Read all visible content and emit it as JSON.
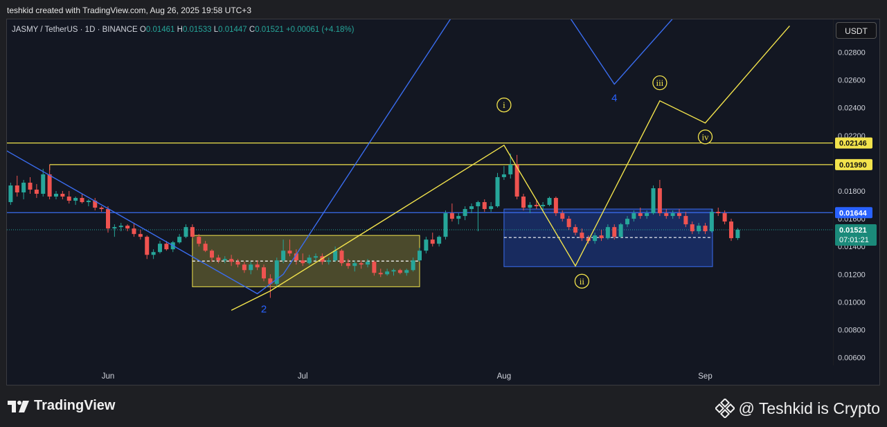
{
  "header": {
    "credit": "teshkid created with TradingView.com, Aug 26, 2025 19:58 UTC+3"
  },
  "symbol_bar": {
    "symbol": "JASMY / TetherUS · 1D · BINANCE",
    "open_label": "O",
    "open": "0.01461",
    "high_label": "H",
    "high": "0.01533",
    "low_label": "L",
    "low": "0.01447",
    "close_label": "C",
    "close": "0.01521",
    "change": "+0.00061 (+4.18%)"
  },
  "currency_button": "USDT",
  "footer": {
    "logo_text": "TradingView",
    "watermark": "@ Teshkid is Crypto"
  },
  "colors": {
    "background": "#131722",
    "up": "#26a69a",
    "down": "#ef5350",
    "yellow": "#f2e34c",
    "blue_line": "#3a6df0",
    "label_blue": "#2962ff",
    "label_green": "#1b8a7a"
  },
  "chart_data": {
    "type": "candlestick",
    "ylim": [
      0.005,
      0.0295
    ],
    "y_ticks": [
      "0.00600",
      "0.00800",
      "0.01000",
      "0.01200",
      "0.01400",
      "0.01600",
      "0.01800",
      "0.02000",
      "0.02200",
      "0.02400",
      "0.02600",
      "0.02800"
    ],
    "x_ticks": [
      {
        "label": "Jun",
        "date": "2025-06-01"
      },
      {
        "label": "Jul",
        "date": "2025-07-01"
      },
      {
        "label": "Aug",
        "date": "2025-08-01"
      },
      {
        "label": "Sep",
        "date": "2025-09-01"
      }
    ],
    "date_range": [
      "2025-05-16",
      "2025-09-13"
    ],
    "candles": [
      {
        "date": "2025-05-16",
        "o": 0.0181,
        "h": 0.019,
        "l": 0.0169,
        "c": 0.0172
      },
      {
        "date": "2025-05-17",
        "o": 0.0172,
        "h": 0.0186,
        "l": 0.017,
        "c": 0.0184
      },
      {
        "date": "2025-05-18",
        "o": 0.0184,
        "h": 0.0191,
        "l": 0.0176,
        "c": 0.0179
      },
      {
        "date": "2025-05-19",
        "o": 0.0179,
        "h": 0.0188,
        "l": 0.0174,
        "c": 0.0186
      },
      {
        "date": "2025-05-20",
        "o": 0.0186,
        "h": 0.019,
        "l": 0.0178,
        "c": 0.0181
      },
      {
        "date": "2025-05-21",
        "o": 0.0181,
        "h": 0.0185,
        "l": 0.0175,
        "c": 0.0178
      },
      {
        "date": "2025-05-22",
        "o": 0.0178,
        "h": 0.0196,
        "l": 0.0176,
        "c": 0.0192
      },
      {
        "date": "2025-05-23",
        "o": 0.0192,
        "h": 0.0199,
        "l": 0.0174,
        "c": 0.0176
      },
      {
        "date": "2025-05-24",
        "o": 0.0176,
        "h": 0.018,
        "l": 0.0174,
        "c": 0.0178
      },
      {
        "date": "2025-05-25",
        "o": 0.0178,
        "h": 0.018,
        "l": 0.0174,
        "c": 0.0176
      },
      {
        "date": "2025-05-26",
        "o": 0.0176,
        "h": 0.018,
        "l": 0.0171,
        "c": 0.0173
      },
      {
        "date": "2025-05-27",
        "o": 0.0173,
        "h": 0.0176,
        "l": 0.017,
        "c": 0.0175
      },
      {
        "date": "2025-05-28",
        "o": 0.0175,
        "h": 0.0178,
        "l": 0.0171,
        "c": 0.0172
      },
      {
        "date": "2025-05-29",
        "o": 0.0172,
        "h": 0.0174,
        "l": 0.0169,
        "c": 0.0173
      },
      {
        "date": "2025-05-30",
        "o": 0.0173,
        "h": 0.0175,
        "l": 0.0166,
        "c": 0.0168
      },
      {
        "date": "2025-05-31",
        "o": 0.0168,
        "h": 0.0169,
        "l": 0.0165,
        "c": 0.0167
      },
      {
        "date": "2025-06-01",
        "o": 0.0167,
        "h": 0.0169,
        "l": 0.015,
        "c": 0.0153
      },
      {
        "date": "2025-06-02",
        "o": 0.0153,
        "h": 0.0156,
        "l": 0.0147,
        "c": 0.0154
      },
      {
        "date": "2025-06-03",
        "o": 0.0154,
        "h": 0.0157,
        "l": 0.0151,
        "c": 0.0155
      },
      {
        "date": "2025-06-04",
        "o": 0.0155,
        "h": 0.0156,
        "l": 0.0151,
        "c": 0.0153
      },
      {
        "date": "2025-06-05",
        "o": 0.0153,
        "h": 0.0157,
        "l": 0.0147,
        "c": 0.0149
      },
      {
        "date": "2025-06-06",
        "o": 0.0149,
        "h": 0.0152,
        "l": 0.0145,
        "c": 0.0147
      },
      {
        "date": "2025-06-07",
        "o": 0.0147,
        "h": 0.0148,
        "l": 0.0131,
        "c": 0.0134
      },
      {
        "date": "2025-06-08",
        "o": 0.0134,
        "h": 0.0138,
        "l": 0.0131,
        "c": 0.0136
      },
      {
        "date": "2025-06-09",
        "o": 0.0136,
        "h": 0.0144,
        "l": 0.0135,
        "c": 0.0142
      },
      {
        "date": "2025-06-10",
        "o": 0.0142,
        "h": 0.0144,
        "l": 0.0137,
        "c": 0.0138
      },
      {
        "date": "2025-06-11",
        "o": 0.0138,
        "h": 0.0144,
        "l": 0.0136,
        "c": 0.0143
      },
      {
        "date": "2025-06-12",
        "o": 0.0143,
        "h": 0.0149,
        "l": 0.0142,
        "c": 0.0147
      },
      {
        "date": "2025-06-13",
        "o": 0.0147,
        "h": 0.0156,
        "l": 0.0146,
        "c": 0.0154
      },
      {
        "date": "2025-06-14",
        "o": 0.0154,
        "h": 0.0156,
        "l": 0.0146,
        "c": 0.0147
      },
      {
        "date": "2025-06-15",
        "o": 0.0147,
        "h": 0.0149,
        "l": 0.014,
        "c": 0.0142
      },
      {
        "date": "2025-06-16",
        "o": 0.0142,
        "h": 0.0144,
        "l": 0.0136,
        "c": 0.0137
      },
      {
        "date": "2025-06-17",
        "o": 0.0137,
        "h": 0.0138,
        "l": 0.0129,
        "c": 0.0132
      },
      {
        "date": "2025-06-18",
        "o": 0.0132,
        "h": 0.0134,
        "l": 0.0128,
        "c": 0.013
      },
      {
        "date": "2025-06-19",
        "o": 0.013,
        "h": 0.0133,
        "l": 0.0128,
        "c": 0.0131
      },
      {
        "date": "2025-06-20",
        "o": 0.0131,
        "h": 0.0134,
        "l": 0.0126,
        "c": 0.0129
      },
      {
        "date": "2025-06-21",
        "o": 0.0129,
        "h": 0.0131,
        "l": 0.0125,
        "c": 0.0127
      },
      {
        "date": "2025-06-22",
        "o": 0.0127,
        "h": 0.0129,
        "l": 0.0121,
        "c": 0.0123
      },
      {
        "date": "2025-06-23",
        "o": 0.0123,
        "h": 0.0129,
        "l": 0.012,
        "c": 0.0127
      },
      {
        "date": "2025-06-24",
        "o": 0.0127,
        "h": 0.013,
        "l": 0.0123,
        "c": 0.0125
      },
      {
        "date": "2025-06-25",
        "o": 0.0125,
        "h": 0.0127,
        "l": 0.0115,
        "c": 0.0117
      },
      {
        "date": "2025-06-26",
        "o": 0.0117,
        "h": 0.012,
        "l": 0.0103,
        "c": 0.0113
      },
      {
        "date": "2025-06-27",
        "o": 0.0113,
        "h": 0.0132,
        "l": 0.0111,
        "c": 0.013
      },
      {
        "date": "2025-06-28",
        "o": 0.013,
        "h": 0.0145,
        "l": 0.0128,
        "c": 0.0137
      },
      {
        "date": "2025-06-29",
        "o": 0.0137,
        "h": 0.0145,
        "l": 0.0133,
        "c": 0.0135
      },
      {
        "date": "2025-06-30",
        "o": 0.0135,
        "h": 0.0138,
        "l": 0.0127,
        "c": 0.013
      },
      {
        "date": "2025-07-01",
        "o": 0.013,
        "h": 0.0135,
        "l": 0.0126,
        "c": 0.0128
      },
      {
        "date": "2025-07-02",
        "o": 0.0128,
        "h": 0.0134,
        "l": 0.0127,
        "c": 0.0132
      },
      {
        "date": "2025-07-03",
        "o": 0.0132,
        "h": 0.0135,
        "l": 0.013,
        "c": 0.0133
      },
      {
        "date": "2025-07-04",
        "o": 0.0133,
        "h": 0.0135,
        "l": 0.0127,
        "c": 0.0129
      },
      {
        "date": "2025-07-05",
        "o": 0.0129,
        "h": 0.0132,
        "l": 0.0127,
        "c": 0.013
      },
      {
        "date": "2025-07-06",
        "o": 0.013,
        "h": 0.014,
        "l": 0.0129,
        "c": 0.0137
      },
      {
        "date": "2025-07-07",
        "o": 0.0137,
        "h": 0.0138,
        "l": 0.0126,
        "c": 0.0128
      },
      {
        "date": "2025-07-08",
        "o": 0.0128,
        "h": 0.0131,
        "l": 0.0124,
        "c": 0.0126
      },
      {
        "date": "2025-07-09",
        "o": 0.0126,
        "h": 0.013,
        "l": 0.0122,
        "c": 0.0128
      },
      {
        "date": "2025-07-10",
        "o": 0.0128,
        "h": 0.013,
        "l": 0.0124,
        "c": 0.0127
      },
      {
        "date": "2025-07-11",
        "o": 0.0127,
        "h": 0.0131,
        "l": 0.0125,
        "c": 0.0129
      },
      {
        "date": "2025-07-12",
        "o": 0.0129,
        "h": 0.013,
        "l": 0.0119,
        "c": 0.0121
      },
      {
        "date": "2025-07-13",
        "o": 0.0121,
        "h": 0.0124,
        "l": 0.0118,
        "c": 0.012
      },
      {
        "date": "2025-07-14",
        "o": 0.012,
        "h": 0.0124,
        "l": 0.0119,
        "c": 0.0122
      },
      {
        "date": "2025-07-15",
        "o": 0.0122,
        "h": 0.0124,
        "l": 0.0119,
        "c": 0.0123
      },
      {
        "date": "2025-07-16",
        "o": 0.0123,
        "h": 0.0124,
        "l": 0.012,
        "c": 0.0121
      },
      {
        "date": "2025-07-17",
        "o": 0.0121,
        "h": 0.0124,
        "l": 0.0119,
        "c": 0.0123
      },
      {
        "date": "2025-07-18",
        "o": 0.0123,
        "h": 0.0132,
        "l": 0.0122,
        "c": 0.013
      },
      {
        "date": "2025-07-19",
        "o": 0.013,
        "h": 0.0139,
        "l": 0.0129,
        "c": 0.0137
      },
      {
        "date": "2025-07-20",
        "o": 0.0137,
        "h": 0.0147,
        "l": 0.0135,
        "c": 0.0145
      },
      {
        "date": "2025-07-21",
        "o": 0.0145,
        "h": 0.015,
        "l": 0.014,
        "c": 0.0142
      },
      {
        "date": "2025-07-22",
        "o": 0.0142,
        "h": 0.0148,
        "l": 0.014,
        "c": 0.0147
      },
      {
        "date": "2025-07-23",
        "o": 0.0147,
        "h": 0.0166,
        "l": 0.0145,
        "c": 0.0164
      },
      {
        "date": "2025-07-24",
        "o": 0.0164,
        "h": 0.0171,
        "l": 0.0158,
        "c": 0.016
      },
      {
        "date": "2025-07-25",
        "o": 0.016,
        "h": 0.0164,
        "l": 0.0156,
        "c": 0.0162
      },
      {
        "date": "2025-07-26",
        "o": 0.0162,
        "h": 0.0169,
        "l": 0.0159,
        "c": 0.0167
      },
      {
        "date": "2025-07-27",
        "o": 0.0167,
        "h": 0.0171,
        "l": 0.0164,
        "c": 0.0169
      },
      {
        "date": "2025-07-28",
        "o": 0.0169,
        "h": 0.0173,
        "l": 0.0151,
        "c": 0.0172
      },
      {
        "date": "2025-07-29",
        "o": 0.0172,
        "h": 0.0174,
        "l": 0.0165,
        "c": 0.0167
      },
      {
        "date": "2025-07-30",
        "o": 0.0167,
        "h": 0.0172,
        "l": 0.0165,
        "c": 0.0169
      },
      {
        "date": "2025-07-31",
        "o": 0.0169,
        "h": 0.0193,
        "l": 0.0168,
        "c": 0.019
      },
      {
        "date": "2025-08-01",
        "o": 0.019,
        "h": 0.0198,
        "l": 0.0188,
        "c": 0.0192
      },
      {
        "date": "2025-08-02",
        "o": 0.0192,
        "h": 0.0207,
        "l": 0.0189,
        "c": 0.0199
      },
      {
        "date": "2025-08-03",
        "o": 0.0199,
        "h": 0.0206,
        "l": 0.0174,
        "c": 0.0176
      },
      {
        "date": "2025-08-04",
        "o": 0.0176,
        "h": 0.0178,
        "l": 0.0166,
        "c": 0.0168
      },
      {
        "date": "2025-08-05",
        "o": 0.0168,
        "h": 0.0172,
        "l": 0.0164,
        "c": 0.017
      },
      {
        "date": "2025-08-06",
        "o": 0.017,
        "h": 0.0174,
        "l": 0.0167,
        "c": 0.0169
      },
      {
        "date": "2025-08-07",
        "o": 0.0169,
        "h": 0.0172,
        "l": 0.0165,
        "c": 0.017
      },
      {
        "date": "2025-08-08",
        "o": 0.017,
        "h": 0.0176,
        "l": 0.0169,
        "c": 0.0175
      },
      {
        "date": "2025-08-09",
        "o": 0.0175,
        "h": 0.0176,
        "l": 0.0162,
        "c": 0.0164
      },
      {
        "date": "2025-08-10",
        "o": 0.0164,
        "h": 0.0166,
        "l": 0.0158,
        "c": 0.016
      },
      {
        "date": "2025-08-11",
        "o": 0.016,
        "h": 0.0162,
        "l": 0.0152,
        "c": 0.0154
      },
      {
        "date": "2025-08-12",
        "o": 0.0154,
        "h": 0.0156,
        "l": 0.0148,
        "c": 0.015
      },
      {
        "date": "2025-08-13",
        "o": 0.015,
        "h": 0.0153,
        "l": 0.0144,
        "c": 0.0146
      },
      {
        "date": "2025-08-14",
        "o": 0.0146,
        "h": 0.0148,
        "l": 0.0142,
        "c": 0.0144
      },
      {
        "date": "2025-08-15",
        "o": 0.0144,
        "h": 0.015,
        "l": 0.0142,
        "c": 0.0148
      },
      {
        "date": "2025-08-16",
        "o": 0.0148,
        "h": 0.0152,
        "l": 0.0144,
        "c": 0.0146
      },
      {
        "date": "2025-08-17",
        "o": 0.0146,
        "h": 0.0156,
        "l": 0.0145,
        "c": 0.0154
      },
      {
        "date": "2025-08-18",
        "o": 0.0154,
        "h": 0.0156,
        "l": 0.0145,
        "c": 0.0147
      },
      {
        "date": "2025-08-19",
        "o": 0.0147,
        "h": 0.0157,
        "l": 0.0146,
        "c": 0.0156
      },
      {
        "date": "2025-08-20",
        "o": 0.0156,
        "h": 0.0162,
        "l": 0.0154,
        "c": 0.016
      },
      {
        "date": "2025-08-21",
        "o": 0.016,
        "h": 0.0166,
        "l": 0.0158,
        "c": 0.0164
      },
      {
        "date": "2025-08-22",
        "o": 0.0164,
        "h": 0.0168,
        "l": 0.016,
        "c": 0.0162
      },
      {
        "date": "2025-08-23",
        "o": 0.0162,
        "h": 0.0166,
        "l": 0.016,
        "c": 0.0164
      },
      {
        "date": "2025-08-24",
        "o": 0.0164,
        "h": 0.0184,
        "l": 0.0163,
        "c": 0.0182
      },
      {
        "date": "2025-08-25",
        "o": 0.0182,
        "h": 0.0188,
        "l": 0.0162,
        "c": 0.0164
      },
      {
        "date": "2025-08-26",
        "o": 0.0164,
        "h": 0.0167,
        "l": 0.016,
        "c": 0.0162
      },
      {
        "date": "2025-08-27",
        "o": 0.0162,
        "h": 0.0166,
        "l": 0.016,
        "c": 0.0164
      },
      {
        "date": "2025-08-28",
        "o": 0.0164,
        "h": 0.0167,
        "l": 0.016,
        "c": 0.0162
      },
      {
        "date": "2025-08-29",
        "o": 0.0162,
        "h": 0.0165,
        "l": 0.0154,
        "c": 0.0156
      },
      {
        "date": "2025-08-30",
        "o": 0.0156,
        "h": 0.0158,
        "l": 0.0149,
        "c": 0.0151
      },
      {
        "date": "2025-08-31",
        "o": 0.0151,
        "h": 0.0157,
        "l": 0.0149,
        "c": 0.0155
      },
      {
        "date": "2025-09-01",
        "o": 0.0155,
        "h": 0.0157,
        "l": 0.0149,
        "c": 0.0151
      },
      {
        "date": "2025-09-02",
        "o": 0.0151,
        "h": 0.0167,
        "l": 0.015,
        "c": 0.0165
      },
      {
        "date": "2025-09-03",
        "o": 0.0165,
        "h": 0.0168,
        "l": 0.0162,
        "c": 0.0164
      },
      {
        "date": "2025-09-04",
        "o": 0.0164,
        "h": 0.0166,
        "l": 0.0156,
        "c": 0.0158
      },
      {
        "date": "2025-09-05",
        "o": 0.0158,
        "h": 0.016,
        "l": 0.0144,
        "c": 0.0146
      },
      {
        "date": "2025-09-06",
        "o": 0.01461,
        "h": 0.01533,
        "l": 0.01447,
        "c": 0.01521
      }
    ],
    "horizontal_lines": [
      {
        "price": 0.02146,
        "label": "0.02146",
        "color": "yellow"
      },
      {
        "price": 0.0199,
        "label": "0.01990",
        "color": "yellow",
        "start": "2025-05-23"
      },
      {
        "price": 0.01644,
        "label": "0.01644",
        "color": "blue"
      }
    ],
    "last_price": {
      "price": 0.01521,
      "label": "0.01521",
      "countdown": "07:01:21"
    },
    "zones": [
      {
        "color": "yellow",
        "start": "2025-06-14",
        "end": "2025-07-19",
        "top": 0.0148,
        "bottom": 0.0111,
        "mid": 0.01295
      },
      {
        "color": "blue",
        "start": "2025-08-01",
        "end": "2025-09-14",
        "top": 0.0167,
        "bottom": 0.01255,
        "mid": 0.01465
      }
    ],
    "wave_lines": [
      {
        "color": "yellow",
        "points": [
          [
            "2025-06-20",
            0.0094
          ],
          [
            "2025-06-26",
            0.0108
          ],
          [
            "2025-08-01",
            0.0213
          ],
          [
            "2025-08-12",
            0.0126
          ],
          [
            "2025-08-25",
            0.0245
          ],
          [
            "2025-09-01",
            0.0229
          ],
          [
            "2025-09-14",
            0.0299
          ]
        ]
      },
      {
        "color": "blue",
        "points": [
          [
            "2025-05-16",
            0.021
          ],
          [
            "2025-06-24",
            0.0106
          ],
          [
            "2025-06-28",
            0.012
          ],
          [
            "2025-07-26",
            0.032
          ]
        ]
      },
      {
        "color": "blue",
        "points": [
          [
            "2025-08-09",
            0.032
          ],
          [
            "2025-08-18",
            0.0257
          ],
          [
            "2025-08-30",
            0.032
          ]
        ]
      }
    ],
    "wave_labels": [
      {
        "text": "2",
        "date": "2025-06-25",
        "price": 0.0095,
        "style": "blue"
      },
      {
        "text": "4",
        "date": "2025-08-18",
        "price": 0.0247,
        "style": "blue"
      },
      {
        "text": "i",
        "date": "2025-08-01",
        "price": 0.0242,
        "style": "yellow-circle"
      },
      {
        "text": "ii",
        "date": "2025-08-13",
        "price": 0.0115,
        "style": "yellow-circle"
      },
      {
        "text": "iii",
        "date": "2025-08-25",
        "price": 0.0258,
        "style": "yellow-circle"
      },
      {
        "text": "iv",
        "date": "2025-09-01",
        "price": 0.0219,
        "style": "yellow-circle"
      }
    ]
  }
}
